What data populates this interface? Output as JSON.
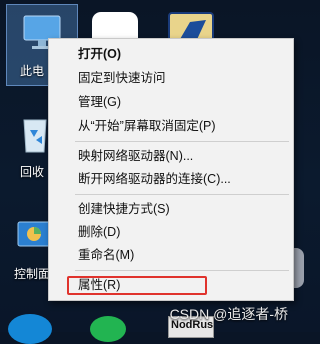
{
  "desktop": {
    "this_pc_label": "此电",
    "recycle_label": "回收",
    "control_label": "控制面",
    "bottom_app_label": "NodRus",
    "watermark": "CSDN @追逐者-桥"
  },
  "menu": {
    "items": [
      {
        "label": "打开(O)",
        "bold": true
      },
      {
        "label": "固定到快速访问"
      },
      {
        "label": "管理(G)"
      },
      {
        "label": "从“开始”屏幕取消固定(P)"
      },
      {
        "label": "映射网络驱动器(N)..."
      },
      {
        "label": "断开网络驱动器的连接(C)..."
      },
      {
        "label": "创建快捷方式(S)"
      },
      {
        "label": "删除(D)"
      },
      {
        "label": "重命名(M)"
      },
      {
        "label": "属性(R)"
      }
    ]
  },
  "highlight_color": "#e0332d"
}
